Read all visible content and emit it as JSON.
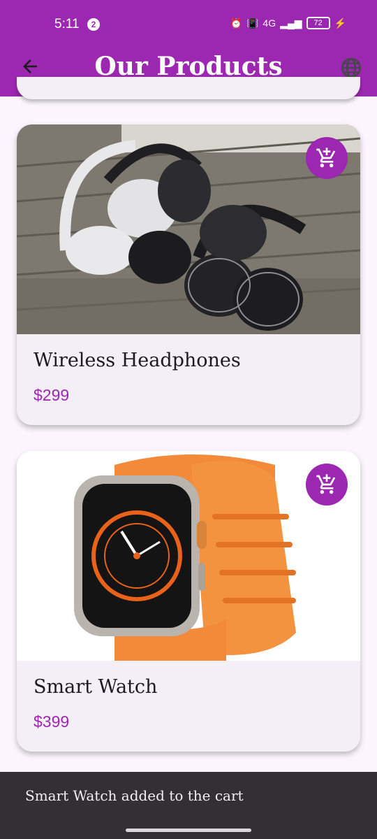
{
  "status_bar": {
    "time": "5:11",
    "notification_count": "2",
    "network": "4G",
    "battery": "72"
  },
  "app_bar": {
    "title": "Our Products",
    "back_icon": "arrow-back-icon",
    "language_icon": "globe-icon"
  },
  "products": [
    {
      "name": "Wireless Headphones",
      "price": "$299",
      "cart_icon": "add-shopping-cart-icon"
    },
    {
      "name": "Smart Watch",
      "price": "$399",
      "cart_icon": "add-shopping-cart-icon"
    }
  ],
  "snackbar": {
    "message": "Smart Watch added to the cart"
  },
  "colors": {
    "primary": "#9c27b0",
    "card": "#f4eef6",
    "snackbar": "#322f35"
  }
}
